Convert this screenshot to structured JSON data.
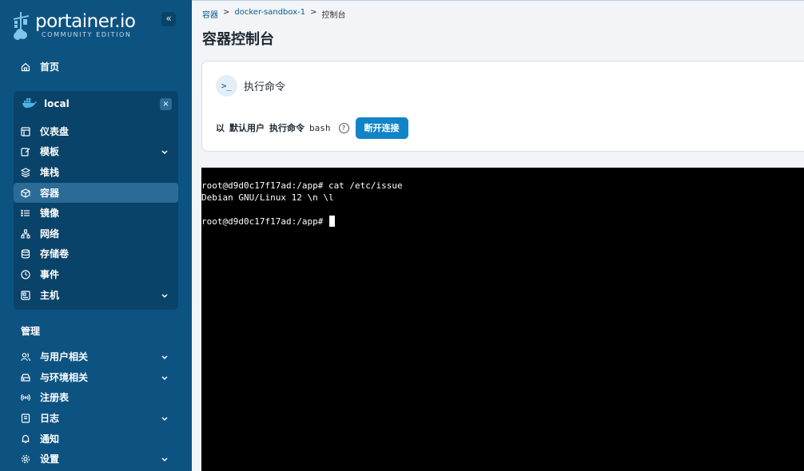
{
  "brand": {
    "name": "portainer.io",
    "edition": "COMMUNITY EDITION"
  },
  "sidebar": {
    "collapse_label": "«",
    "home": "首页",
    "environment": {
      "name": "local",
      "close": "×"
    },
    "env_items": [
      {
        "label": "仪表盘",
        "icon": "dashboard-icon"
      },
      {
        "label": "模板",
        "icon": "edit-icon",
        "expandable": true
      },
      {
        "label": "堆栈",
        "icon": "layers-icon"
      },
      {
        "label": "容器",
        "icon": "box-icon",
        "active": true
      },
      {
        "label": "镜像",
        "icon": "list-icon"
      },
      {
        "label": "网络",
        "icon": "network-icon"
      },
      {
        "label": "存储卷",
        "icon": "database-icon"
      },
      {
        "label": "事件",
        "icon": "clock-icon"
      },
      {
        "label": "主机",
        "icon": "host-icon",
        "expandable": true
      }
    ],
    "admin_title": "管理",
    "admin_items": [
      {
        "label": "与用户相关",
        "icon": "users-icon",
        "expandable": true
      },
      {
        "label": "与环境相关",
        "icon": "drive-icon",
        "expandable": true
      },
      {
        "label": "注册表",
        "icon": "broadcast-icon"
      },
      {
        "label": "日志",
        "icon": "log-icon",
        "expandable": true
      },
      {
        "label": "通知",
        "icon": "bell-icon"
      },
      {
        "label": "设置",
        "icon": "gear-icon",
        "expandable": true
      }
    ]
  },
  "breadcrumb": {
    "root": "容器",
    "sep": ">",
    "container": "docker-sandbox-1",
    "current": "控制台"
  },
  "page_title": "容器控制台",
  "card": {
    "icon": ">_",
    "title": "执行命令",
    "as": "以",
    "user": "默认用户",
    "exec": "执行命令",
    "shell": "bash",
    "help": "?",
    "disconnect": "断开连接"
  },
  "terminal": {
    "lines": [
      "root@d9d0c17f17ad:/app# cat /etc/issue",
      "Debian GNU/Linux 12 \\n \\l",
      "",
      "root@d9d0c17f17ad:/app# "
    ]
  }
}
